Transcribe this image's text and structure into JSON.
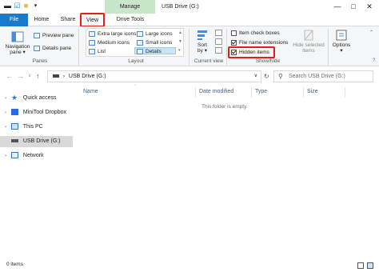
{
  "titlebar": {
    "manage_tab": "Manage",
    "window_title": "USB Drive (G:)",
    "minimize": "—",
    "maximize": "□",
    "close": "✕"
  },
  "tabs": {
    "file": "File",
    "home": "Home",
    "share": "Share",
    "view": "View",
    "drive_tools": "Drive Tools"
  },
  "ribbon": {
    "panes": {
      "navigation_pane": "Navigation",
      "navigation_pane_2": "pane",
      "navigation_pane_arrow": "▾",
      "preview_pane": "Preview pane",
      "details_pane": "Details pane",
      "group_label": "Panes"
    },
    "layout": {
      "extra_large_icons": "Extra large icons",
      "large_icons": "Large icons",
      "medium_icons": "Medium icons",
      "small_icons": "Small icons",
      "list": "List",
      "details": "Details",
      "group_label": "Layout"
    },
    "current_view": {
      "sort_by": "Sort",
      "sort_by_2": "by",
      "sort_arrow": "▾",
      "group_label": "Current view"
    },
    "show_hide": {
      "item_check_boxes": "Item check boxes",
      "item_check_boxes_checked": false,
      "file_name_extensions": "File name extensions",
      "file_name_extensions_checked": true,
      "hidden_items": "Hidden items",
      "hidden_items_checked": true,
      "hide_selected": "Hide selected",
      "hide_selected_2": "items",
      "group_label": "Show/hide"
    },
    "options": {
      "label": "Options",
      "arrow": "▾"
    }
  },
  "addressbar": {
    "back": "←",
    "forward": "→",
    "recent": "∨",
    "up": "↑",
    "path": "USB Drive (G:)",
    "dropdown": "∨",
    "refresh": "↻",
    "search_placeholder": "Search USB Drive (G:)"
  },
  "navpane": {
    "items": [
      {
        "label": "Quick access",
        "icon": "star-icon"
      },
      {
        "label": "MiniTool Dropbox",
        "icon": "dropbox-icon"
      },
      {
        "label": "This PC",
        "icon": "computer-icon"
      },
      {
        "label": "USB Drive (G:)",
        "icon": "usb-drive-icon"
      },
      {
        "label": "Network",
        "icon": "network-icon"
      }
    ]
  },
  "content": {
    "columns": [
      "Name",
      "Date modified",
      "Type",
      "Size"
    ],
    "empty_message": "This folder is empty."
  },
  "statusbar": {
    "item_count": "0 items"
  },
  "colors": {
    "file_tab": "#1979ca",
    "manage_tab": "#c8e6c9",
    "highlight": "#e0201b",
    "selected_nav": "#d9d9d9"
  }
}
